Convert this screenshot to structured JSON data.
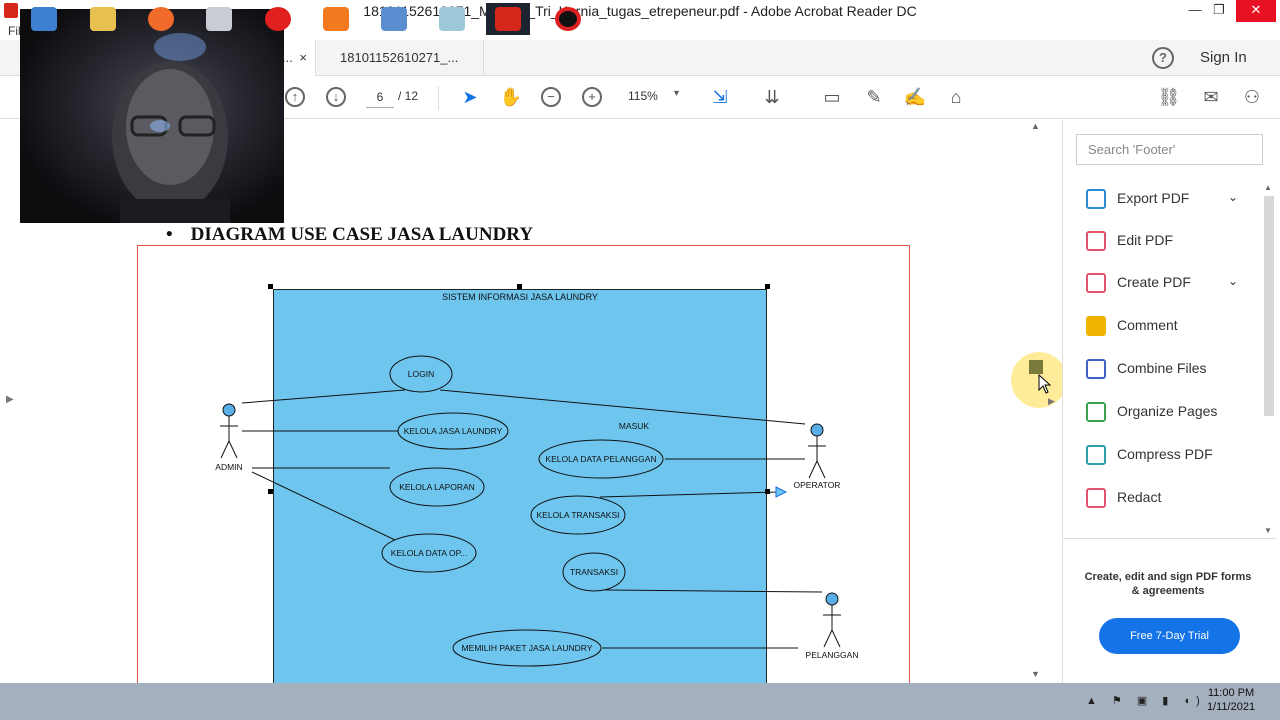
{
  "window": {
    "title": "18101152610271_M.Reza_Tri_Kurnia_tugas_etrepeneur.pdf - Adobe Acrobat Reader DC",
    "minimize": "—",
    "maximize": "❐",
    "close": "✕",
    "menu_fragment": "Fil"
  },
  "tabs": {
    "active_suffix": "...",
    "close": "×",
    "other": "18101152610271_..."
  },
  "header": {
    "help": "?",
    "sign_in": "Sign In"
  },
  "toolbar": {
    "page_current": "6",
    "page_total": "/ 12",
    "zoom": "115%",
    "zoom_caret": "▾"
  },
  "document": {
    "bullet": "•",
    "heading": "DIAGRAM USE CASE JASA LAUNDRY",
    "system_label": "SISTEM INFORMASI JASA LAUNDRY",
    "use_cases": [
      "LOGIN",
      "KELOLA JASA LAUNDRY",
      "KELOLA LAPORAN",
      "KELOLA DATA OP...",
      "KELOLA DATA PELANGGAN",
      "KELOLA TRANSAKSI",
      "TRANSAKSI",
      "MEMILIH PAKET JASA LAUNDRY"
    ],
    "masuk_label": "MASUK",
    "actors": [
      "ADMIN",
      "OPERATOR",
      "PELANGGAN"
    ]
  },
  "right_pane": {
    "search_placeholder": "Search 'Footer'",
    "tools": [
      {
        "label": "Export PDF",
        "color": "#2d8cd0"
      },
      {
        "label": "Edit PDF",
        "color": "#e0526d"
      },
      {
        "label": "Create PDF",
        "color": "#e0526d"
      },
      {
        "label": "Comment",
        "color": "#f0b400"
      },
      {
        "label": "Combine Files",
        "color": "#4060c8"
      },
      {
        "label": "Organize Pages",
        "color": "#3aa352"
      },
      {
        "label": "Compress PDF",
        "color": "#2aa0a8"
      },
      {
        "label": "Redact",
        "color": "#e0526d"
      }
    ],
    "chevron": "⌄",
    "promo": "Create, edit and sign PDF forms & agreements",
    "trial_button": "Free 7-Day Trial"
  },
  "taskbar": {
    "time": "11:00 PM",
    "date": "1/11/2021",
    "tray": "▲ ⚑ ▣ ▮ ◖)"
  },
  "colors": {
    "system_fill": "#6ec6ef",
    "frame_border": "#e05a4a",
    "trial_button": "#1473e6",
    "taskbar": "#a5b0be"
  }
}
